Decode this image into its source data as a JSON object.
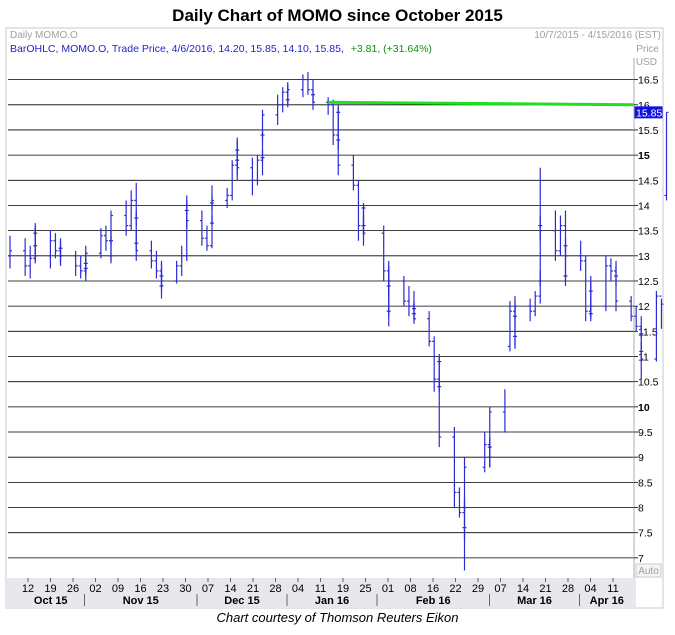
{
  "page": {
    "title": "Daily Chart of MOMO since October 2015",
    "caption": "Chart courtesy of Thomson Reuters Eikon"
  },
  "panel": {
    "name": "Daily MOMO.O",
    "date_range": "10/7/2015 - 4/15/2016 (EST)",
    "legend_text": "BarOHLC, MOMO.O, Trade Price, 4/6/2016, 14.20, 15.85, 14.10, 15.85,",
    "change_text": "+3.81, (+31.64%)",
    "axis_title": "Price",
    "axis_unit": "USD",
    "auto_label": "Auto",
    "last_price_label": "15.85"
  },
  "colors": {
    "bars": "#2b2bd6",
    "resistance": "#22dd22",
    "last_price_bg": "#1010e0",
    "legend_text": "#2222cc",
    "change_text": "#109010",
    "grid": "#000000",
    "axis_strip": "#e8e8ec",
    "light_text": "#a0a0a0"
  },
  "chart_data": {
    "type": "ohlc",
    "title": "Daily Chart of MOMO since October 2015",
    "ylim": [
      6.6,
      16.85
    ],
    "yticks": [
      {
        "value": 16.5,
        "label": "16.5"
      },
      {
        "value": 16,
        "label": "16"
      },
      {
        "value": 15.5,
        "label": "15.5"
      },
      {
        "value": 15,
        "label": "15"
      },
      {
        "value": 14.5,
        "label": "14.5"
      },
      {
        "value": 14,
        "label": "14"
      },
      {
        "value": 13.5,
        "label": "13.5"
      },
      {
        "value": 13,
        "label": "13"
      },
      {
        "value": 12.5,
        "label": "12.5"
      },
      {
        "value": 12,
        "label": "12"
      },
      {
        "value": 11.5,
        "label": "11.5"
      },
      {
        "value": 11,
        "label": "11"
      },
      {
        "value": 10.5,
        "label": "10.5"
      },
      {
        "value": 10,
        "label": "10"
      },
      {
        "value": 9.5,
        "label": "9.5"
      },
      {
        "value": 9,
        "label": "9"
      },
      {
        "value": 8.5,
        "label": "8.5"
      },
      {
        "value": 8,
        "label": "8"
      },
      {
        "value": 7.5,
        "label": "7.5"
      },
      {
        "value": 7,
        "label": "7"
      }
    ],
    "bold_ticks": [
      15,
      10
    ],
    "day_ticks": [
      "12",
      "19",
      "26",
      "02",
      "09",
      "16",
      "23",
      "30",
      "07",
      "14",
      "21",
      "28",
      "04",
      "11",
      "19",
      "25",
      "01",
      "08",
      "16",
      "22",
      "29",
      "07",
      "14",
      "21",
      "28",
      "04",
      "11"
    ],
    "month_labels": [
      "Oct 15",
      "Nov 15",
      "Dec 15",
      "Jan 16",
      "Feb 16",
      "Mar 16",
      "Apr 16"
    ],
    "month_tick_index": [
      0,
      3,
      8,
      12,
      16,
      21,
      25
    ],
    "resistance": {
      "start_value": 16.05,
      "end_value": 16.0,
      "start_date": "2016-01-04",
      "end_date": "2016-04-15"
    },
    "last_price": 15.85,
    "bars": [
      {
        "date": "2015-10-09",
        "o": 13.0,
        "h": 13.4,
        "l": 12.75,
        "c": 13.1
      },
      {
        "date": "2015-10-12",
        "o": 13.1,
        "h": 13.35,
        "l": 12.6,
        "c": 12.8
      },
      {
        "date": "2015-10-13",
        "o": 12.8,
        "h": 13.2,
        "l": 12.55,
        "c": 12.95
      },
      {
        "date": "2015-10-14",
        "o": 12.95,
        "h": 13.6,
        "l": 12.85,
        "c": 13.45
      },
      {
        "date": "2015-10-15",
        "o": 13.45,
        "h": 13.65,
        "l": 13.05,
        "c": 13.2
      },
      {
        "date": "2015-10-16",
        "o": 13.2,
        "h": 13.55,
        "l": 12.9,
        "c": 13.0
      },
      {
        "date": "2015-10-19",
        "o": 13.0,
        "h": 13.5,
        "l": 12.75,
        "c": 13.3
      },
      {
        "date": "2015-10-20",
        "o": 13.3,
        "h": 13.45,
        "l": 12.95,
        "c": 13.1
      },
      {
        "date": "2015-10-21",
        "o": 13.1,
        "h": 13.3,
        "l": 12.85,
        "c": 13.0
      },
      {
        "date": "2015-10-22",
        "o": 13.0,
        "h": 13.25,
        "l": 12.8,
        "c": 13.15
      },
      {
        "date": "2015-10-23",
        "o": 13.15,
        "h": 13.35,
        "l": 12.9,
        "c": 13.0
      },
      {
        "date": "2015-10-26",
        "o": 13.0,
        "h": 13.1,
        "l": 12.6,
        "c": 12.8
      },
      {
        "date": "2015-10-27",
        "o": 12.8,
        "h": 13.0,
        "l": 12.55,
        "c": 12.7
      },
      {
        "date": "2015-10-28",
        "o": 12.7,
        "h": 12.95,
        "l": 12.5,
        "c": 12.85
      },
      {
        "date": "2015-10-29",
        "o": 12.85,
        "h": 13.05,
        "l": 12.6,
        "c": 12.75
      },
      {
        "date": "2015-10-30",
        "o": 12.75,
        "h": 13.2,
        "l": 12.65,
        "c": 13.05
      },
      {
        "date": "2015-11-02",
        "o": 13.05,
        "h": 13.55,
        "l": 12.95,
        "c": 13.4
      },
      {
        "date": "2015-11-03",
        "o": 13.4,
        "h": 13.6,
        "l": 13.1,
        "c": 13.3
      },
      {
        "date": "2015-11-04",
        "o": 13.3,
        "h": 13.5,
        "l": 12.9,
        "c": 13.0
      },
      {
        "date": "2015-11-05",
        "o": 13.0,
        "h": 13.4,
        "l": 12.85,
        "c": 13.3
      },
      {
        "date": "2015-11-06",
        "o": 13.3,
        "h": 13.9,
        "l": 13.2,
        "c": 13.8
      },
      {
        "date": "2015-11-09",
        "o": 13.8,
        "h": 14.1,
        "l": 13.4,
        "c": 13.6
      },
      {
        "date": "2015-11-10",
        "o": 13.6,
        "h": 14.3,
        "l": 13.5,
        "c": 14.1
      },
      {
        "date": "2015-11-11",
        "o": 14.1,
        "h": 14.45,
        "l": 13.6,
        "c": 13.75
      },
      {
        "date": "2015-11-12",
        "o": 13.75,
        "h": 13.9,
        "l": 13.1,
        "c": 13.25
      },
      {
        "date": "2015-11-13",
        "o": 13.25,
        "h": 13.5,
        "l": 12.9,
        "c": 13.1
      },
      {
        "date": "2015-11-16",
        "o": 13.1,
        "h": 13.3,
        "l": 12.75,
        "c": 12.9
      },
      {
        "date": "2015-11-17",
        "o": 12.9,
        "h": 13.1,
        "l": 12.55,
        "c": 12.7
      },
      {
        "date": "2015-11-18",
        "o": 12.7,
        "h": 12.9,
        "l": 12.15,
        "c": 12.4
      },
      {
        "date": "2015-11-19",
        "o": 12.4,
        "h": 12.75,
        "l": 12.3,
        "c": 12.6
      },
      {
        "date": "2015-11-20",
        "o": 12.6,
        "h": 12.85,
        "l": 12.4,
        "c": 12.5
      },
      {
        "date": "2015-11-23",
        "o": 12.5,
        "h": 12.9,
        "l": 12.45,
        "c": 12.8
      },
      {
        "date": "2015-11-24",
        "o": 12.8,
        "h": 13.2,
        "l": 12.6,
        "c": 13.0
      },
      {
        "date": "2015-11-25",
        "o": 13.0,
        "h": 14.2,
        "l": 12.9,
        "c": 13.9
      },
      {
        "date": "2015-11-27",
        "o": 13.9,
        "h": 14.1,
        "l": 13.55,
        "c": 13.7
      },
      {
        "date": "2015-11-30",
        "o": 13.7,
        "h": 13.9,
        "l": 13.2,
        "c": 13.35
      },
      {
        "date": "2015-12-01",
        "o": 13.35,
        "h": 13.6,
        "l": 13.1,
        "c": 13.2
      },
      {
        "date": "2015-12-02",
        "o": 13.2,
        "h": 13.8,
        "l": 13.15,
        "c": 13.65
      },
      {
        "date": "2015-12-03",
        "o": 13.65,
        "h": 14.2,
        "l": 13.6,
        "c": 14.05
      },
      {
        "date": "2015-12-04",
        "o": 14.05,
        "h": 14.4,
        "l": 13.9,
        "c": 14.1
      },
      {
        "date": "2015-12-07",
        "o": 14.1,
        "h": 14.35,
        "l": 13.95,
        "c": 14.2
      },
      {
        "date": "2015-12-08",
        "o": 14.2,
        "h": 14.9,
        "l": 14.1,
        "c": 14.8
      },
      {
        "date": "2015-12-09",
        "o": 14.8,
        "h": 15.3,
        "l": 14.6,
        "c": 15.1
      },
      {
        "date": "2015-12-10",
        "o": 15.1,
        "h": 15.35,
        "l": 14.75,
        "c": 14.9
      },
      {
        "date": "2015-12-11",
        "o": 14.9,
        "h": 15.1,
        "l": 14.5,
        "c": 14.75
      },
      {
        "date": "2015-12-14",
        "o": 14.75,
        "h": 14.95,
        "l": 14.2,
        "c": 14.5
      },
      {
        "date": "2015-12-15",
        "o": 14.5,
        "h": 15.0,
        "l": 14.4,
        "c": 14.9
      },
      {
        "date": "2015-12-16",
        "o": 14.9,
        "h": 15.1,
        "l": 14.6,
        "c": 14.95
      },
      {
        "date": "2015-12-17",
        "o": 14.95,
        "h": 15.5,
        "l": 14.85,
        "c": 15.4
      },
      {
        "date": "2015-12-18",
        "o": 15.4,
        "h": 15.9,
        "l": 15.3,
        "c": 15.8
      },
      {
        "date": "2015-12-21",
        "o": 15.8,
        "h": 16.2,
        "l": 15.6,
        "c": 16.0
      },
      {
        "date": "2015-12-22",
        "o": 16.0,
        "h": 16.35,
        "l": 15.85,
        "c": 16.25
      },
      {
        "date": "2015-12-23",
        "o": 16.25,
        "h": 16.45,
        "l": 16.0,
        "c": 16.1
      },
      {
        "date": "2015-12-24",
        "o": 16.1,
        "h": 16.4,
        "l": 15.95,
        "c": 16.3
      },
      {
        "date": "2015-12-28",
        "o": 16.3,
        "h": 16.6,
        "l": 16.15,
        "c": 16.5
      },
      {
        "date": "2015-12-29",
        "o": 16.5,
        "h": 16.65,
        "l": 16.2,
        "c": 16.3
      },
      {
        "date": "2015-12-30",
        "o": 16.3,
        "h": 16.5,
        "l": 16.05,
        "c": 16.2
      },
      {
        "date": "2015-12-31",
        "o": 16.2,
        "h": 16.3,
        "l": 15.9,
        "c": 16.05
      },
      {
        "date": "2016-01-04",
        "o": 16.05,
        "h": 16.15,
        "l": 15.8,
        "c": 16.0
      },
      {
        "date": "2016-01-05",
        "o": 16.0,
        "h": 16.1,
        "l": 15.2,
        "c": 15.4
      },
      {
        "date": "2016-01-06",
        "o": 15.4,
        "h": 16.0,
        "l": 15.3,
        "c": 15.85
      },
      {
        "date": "2016-01-07",
        "o": 15.85,
        "h": 15.95,
        "l": 15.1,
        "c": 15.3
      },
      {
        "date": "2016-01-08",
        "o": 15.3,
        "h": 15.4,
        "l": 14.6,
        "c": 14.8
      },
      {
        "date": "2016-01-11",
        "o": 14.8,
        "h": 15.0,
        "l": 14.3,
        "c": 14.4
      },
      {
        "date": "2016-01-12",
        "o": 14.4,
        "h": 14.5,
        "l": 13.3,
        "c": 13.6
      },
      {
        "date": "2016-01-13",
        "o": 13.6,
        "h": 14.05,
        "l": 13.4,
        "c": 13.95
      },
      {
        "date": "2016-01-14",
        "o": 13.95,
        "h": 14.0,
        "l": 13.4,
        "c": 13.6
      },
      {
        "date": "2016-01-15",
        "o": 13.6,
        "h": 13.8,
        "l": 13.2,
        "c": 13.45
      },
      {
        "date": "2016-01-19",
        "o": 13.45,
        "h": 13.6,
        "l": 12.5,
        "c": 12.7
      },
      {
        "date": "2016-01-20",
        "o": 12.7,
        "h": 12.9,
        "l": 11.6,
        "c": 11.9
      },
      {
        "date": "2016-01-21",
        "o": 11.9,
        "h": 12.6,
        "l": 11.8,
        "c": 12.4
      },
      {
        "date": "2016-01-22",
        "o": 12.4,
        "h": 12.8,
        "l": 12.2,
        "c": 12.5
      },
      {
        "date": "2016-01-25",
        "o": 12.5,
        "h": 12.6,
        "l": 12.0,
        "c": 12.1
      },
      {
        "date": "2016-01-26",
        "o": 12.1,
        "h": 12.4,
        "l": 11.8,
        "c": 12.0
      },
      {
        "date": "2016-01-27",
        "o": 12.0,
        "h": 12.3,
        "l": 11.75,
        "c": 11.85
      },
      {
        "date": "2016-01-28",
        "o": 11.85,
        "h": 12.1,
        "l": 11.7,
        "c": 11.95
      },
      {
        "date": "2016-01-29",
        "o": 11.95,
        "h": 12.05,
        "l": 11.65,
        "c": 11.75
      },
      {
        "date": "2016-02-01",
        "o": 11.75,
        "h": 11.9,
        "l": 11.2,
        "c": 11.3
      },
      {
        "date": "2016-02-02",
        "o": 11.3,
        "h": 11.4,
        "l": 10.3,
        "c": 10.55
      },
      {
        "date": "2016-02-03",
        "o": 10.55,
        "h": 11.05,
        "l": 10.4,
        "c": 10.9
      },
      {
        "date": "2016-02-04",
        "o": 10.9,
        "h": 11.0,
        "l": 10.3,
        "c": 10.4
      },
      {
        "date": "2016-02-05",
        "o": 10.4,
        "h": 10.5,
        "l": 9.2,
        "c": 9.4
      },
      {
        "date": "2016-02-08",
        "o": 9.4,
        "h": 9.6,
        "l": 8.0,
        "c": 8.3
      },
      {
        "date": "2016-02-09",
        "o": 8.3,
        "h": 8.4,
        "l": 7.8,
        "c": 7.9
      },
      {
        "date": "2016-02-10",
        "o": 7.9,
        "h": 8.1,
        "l": 6.75,
        "c": 7.6
      },
      {
        "date": "2016-02-11",
        "o": 7.6,
        "h": 8.2,
        "l": 7.35,
        "c": 8.0
      },
      {
        "date": "2016-02-12",
        "o": 8.0,
        "h": 9.0,
        "l": 7.9,
        "c": 8.8
      },
      {
        "date": "2016-02-16",
        "o": 8.8,
        "h": 9.5,
        "l": 8.7,
        "c": 9.25
      },
      {
        "date": "2016-02-17",
        "o": 9.25,
        "h": 9.4,
        "l": 8.8,
        "c": 9.0
      },
      {
        "date": "2016-02-18",
        "o": 9.0,
        "h": 9.35,
        "l": 8.8,
        "c": 9.2
      },
      {
        "date": "2016-02-19",
        "o": 9.2,
        "h": 10.0,
        "l": 9.1,
        "c": 9.9
      },
      {
        "date": "2016-02-22",
        "o": 9.9,
        "h": 10.35,
        "l": 9.5,
        "c": 9.5
      },
      {
        "date": "2016-02-23",
        "o": 11.2,
        "h": 12.1,
        "l": 11.1,
        "c": 11.9
      },
      {
        "date": "2016-02-24",
        "o": 11.9,
        "h": 12.0,
        "l": 11.15,
        "c": 11.4
      },
      {
        "date": "2016-02-25",
        "o": 11.4,
        "h": 12.1,
        "l": 11.2,
        "c": 11.8
      },
      {
        "date": "2016-02-26",
        "o": 11.8,
        "h": 12.2,
        "l": 11.7,
        "c": 12.0
      },
      {
        "date": "2016-02-29",
        "o": 12.0,
        "h": 12.15,
        "l": 11.7,
        "c": 11.9
      },
      {
        "date": "2016-03-01",
        "o": 11.9,
        "h": 12.3,
        "l": 11.8,
        "c": 12.2
      },
      {
        "date": "2016-03-02",
        "o": 12.2,
        "h": 12.7,
        "l": 12.05,
        "c": 12.5
      },
      {
        "date": "2016-03-03",
        "o": 12.5,
        "h": 13.8,
        "l": 12.4,
        "c": 13.6
      },
      {
        "date": "2016-03-04",
        "o": 13.6,
        "h": 14.75,
        "l": 13.3,
        "c": 13.5
      },
      {
        "date": "2016-03-07",
        "o": 13.5,
        "h": 13.9,
        "l": 12.9,
        "c": 13.1
      },
      {
        "date": "2016-03-08",
        "o": 13.1,
        "h": 13.8,
        "l": 13.0,
        "c": 13.6
      },
      {
        "date": "2016-03-09",
        "o": 13.6,
        "h": 13.9,
        "l": 13.05,
        "c": 13.2
      },
      {
        "date": "2016-03-10",
        "o": 13.2,
        "h": 13.35,
        "l": 12.4,
        "c": 12.6
      },
      {
        "date": "2016-03-11",
        "o": 12.6,
        "h": 13.2,
        "l": 12.5,
        "c": 13.0
      },
      {
        "date": "2016-03-14",
        "o": 13.0,
        "h": 13.3,
        "l": 12.7,
        "c": 12.9
      },
      {
        "date": "2016-03-15",
        "o": 12.9,
        "h": 13.0,
        "l": 11.7,
        "c": 11.9
      },
      {
        "date": "2016-03-16",
        "o": 11.9,
        "h": 12.5,
        "l": 11.8,
        "c": 12.3
      },
      {
        "date": "2016-03-17",
        "o": 12.3,
        "h": 12.6,
        "l": 11.7,
        "c": 11.85
      },
      {
        "date": "2016-03-18",
        "o": 11.85,
        "h": 12.1,
        "l": 11.75,
        "c": 12.0
      },
      {
        "date": "2016-03-21",
        "o": 12.0,
        "h": 13.0,
        "l": 11.9,
        "c": 12.8
      },
      {
        "date": "2016-03-22",
        "o": 12.8,
        "h": 12.95,
        "l": 12.5,
        "c": 12.7
      },
      {
        "date": "2016-03-23",
        "o": 12.7,
        "h": 12.9,
        "l": 12.4,
        "c": 12.6
      },
      {
        "date": "2016-03-24",
        "o": 12.6,
        "h": 12.8,
        "l": 11.9,
        "c": 12.1
      },
      {
        "date": "2016-03-28",
        "o": 12.1,
        "h": 12.2,
        "l": 11.7,
        "c": 11.8
      },
      {
        "date": "2016-03-29",
        "o": 11.8,
        "h": 12.0,
        "l": 11.5,
        "c": 11.6
      },
      {
        "date": "2016-03-30",
        "o": 11.6,
        "h": 11.8,
        "l": 11.35,
        "c": 11.45
      },
      {
        "date": "2016-03-31",
        "o": 11.45,
        "h": 11.6,
        "l": 10.9,
        "c": 11.1
      },
      {
        "date": "2016-04-01",
        "o": 11.1,
        "h": 11.3,
        "l": 10.55,
        "c": 10.95
      },
      {
        "date": "2016-04-04",
        "o": 10.95,
        "h": 12.3,
        "l": 10.9,
        "c": 12.2
      },
      {
        "date": "2016-04-05",
        "o": 12.2,
        "h": 12.15,
        "l": 11.55,
        "c": 12.04
      },
      {
        "date": "2016-04-06",
        "o": 14.2,
        "h": 15.85,
        "l": 14.1,
        "c": 15.85
      }
    ]
  }
}
